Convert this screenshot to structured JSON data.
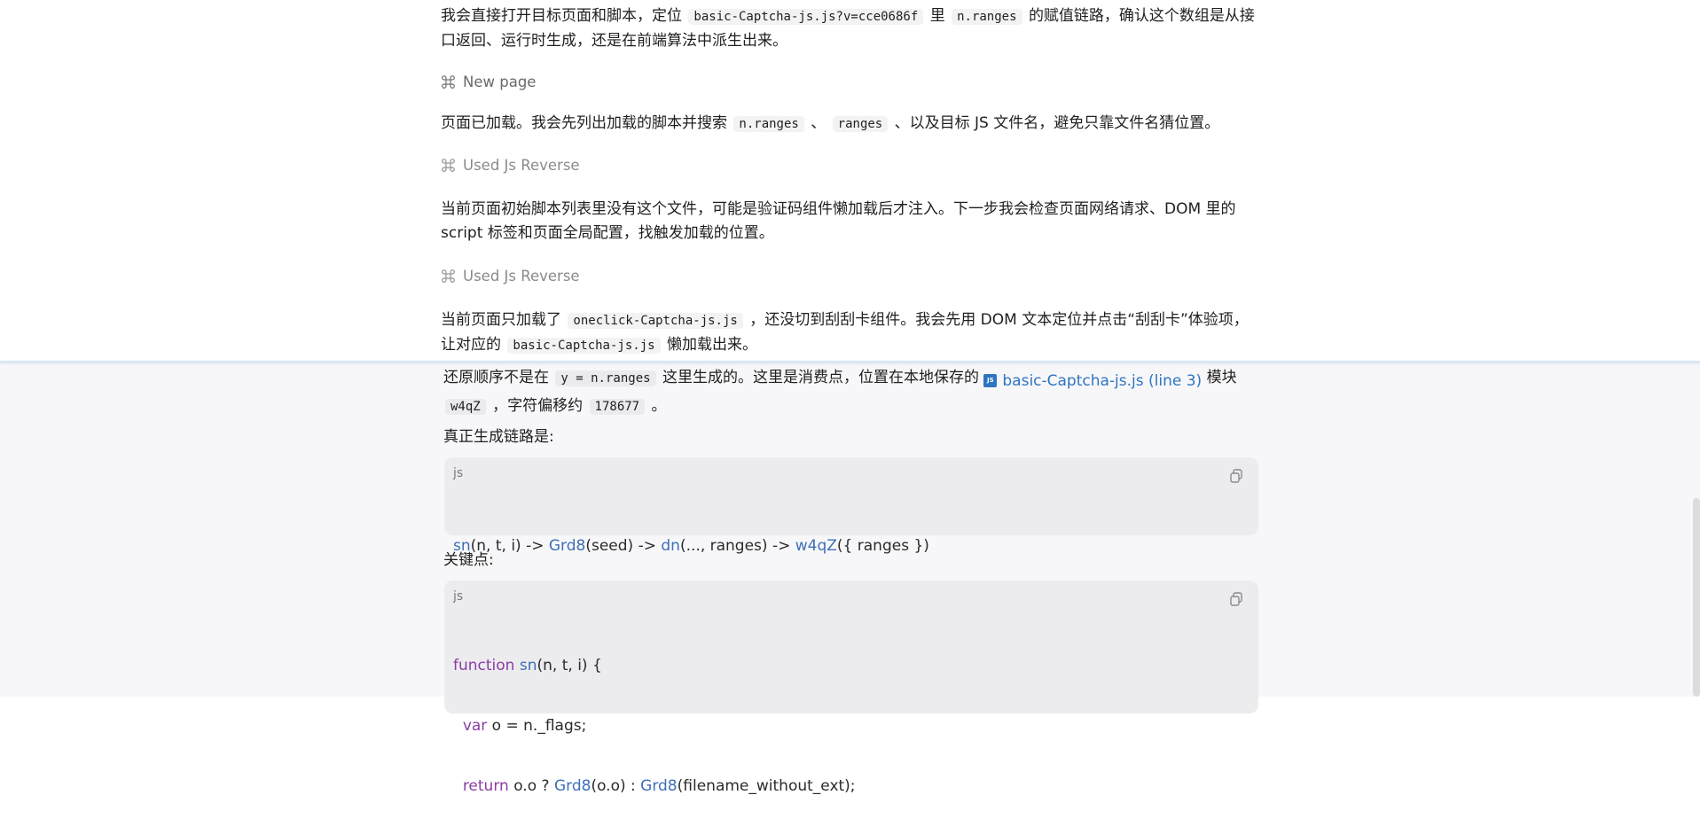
{
  "top": {
    "p1": {
      "a": "我会直接打开目标页面和脚本，定位",
      "code1": "basic-Captcha-js.js?v=cce0686f",
      "b": "里",
      "code2": "n.ranges",
      "c": "的赋值链路，确认这个数组是从接口返回、运行时生成，还是在前端算法中派生出来。"
    },
    "tool1": {
      "icon": "command-icon",
      "label": "New page"
    },
    "p2": {
      "a": "页面已加载。我会先列出加载的脚本并搜索",
      "code1": "n.ranges",
      "b": "、",
      "code2": "ranges",
      "c": "、以及目标 JS 文件名，避免只靠文件名猜位置。"
    },
    "tool2": {
      "icon": "command-icon",
      "label": "Used Js Reverse"
    },
    "p3": {
      "text": "当前页面初始脚本列表里没有这个文件，可能是验证码组件懒加载后才注入。下一步我会检查页面网络请求、DOM 里的 script 标签和页面全局配置，找触发加载的位置。"
    },
    "tool3": {
      "icon": "command-icon",
      "label": "Used Js Reverse"
    },
    "p4": {
      "a": "当前页面只加载了",
      "code1": "oneclick-Captcha-js.js",
      "b": "，还没切到刮刮卡组件。我会先用 DOM 文本定位并点击“刮刮卡”体验项，让对应的",
      "code2": "basic-Captcha-js.js",
      "c": "懒加载出来。"
    }
  },
  "bottom": {
    "p1": {
      "a": "还原顺序不是在",
      "code1": "y = n.ranges",
      "b": "这里生成的。这里是消费点，位置在本地保存的",
      "link_badge": "JS",
      "link": "basic-Captcha-js.js (line 3)",
      "c": "模块",
      "code2": "w4qZ",
      "d": "，字符偏移约",
      "code3": "178677",
      "e": "。"
    },
    "h1": "真正生成链路是:",
    "code_block_1": {
      "lang": "js",
      "copy_icon": "copy-icon",
      "line1": {
        "t1": "sn",
        "t2": "(n, t, i) -> ",
        "t3": "Grd8",
        "t4": "(seed) -> ",
        "t5": "dn",
        "t6": "(..., ranges) -> ",
        "t7": "w4qZ",
        "t8": "({ ranges })"
      }
    },
    "h2": "关键点:",
    "code_block_2": {
      "lang": "js",
      "copy_icon": "copy-icon",
      "line1": {
        "kw": "function",
        "sp": " ",
        "fn": "sn",
        "rest": "(n, t, i) {"
      },
      "line2": {
        "indent": "  ",
        "kw": "var",
        "rest": " o = n._flags;"
      },
      "line3": {
        "indent": "  ",
        "kw": "return",
        "r1": " o.o ? ",
        "fn1": "Grd8",
        "r2": "(o.o) : ",
        "fn2": "Grd8",
        "r3": "(filename_without_ext);"
      }
    }
  },
  "colors": {
    "link": "#2f74c0",
    "function": "#3f6fb6",
    "keyword": "#8a3ea3",
    "muted": "#8a8a8a",
    "divider": "#d7e6f4"
  }
}
